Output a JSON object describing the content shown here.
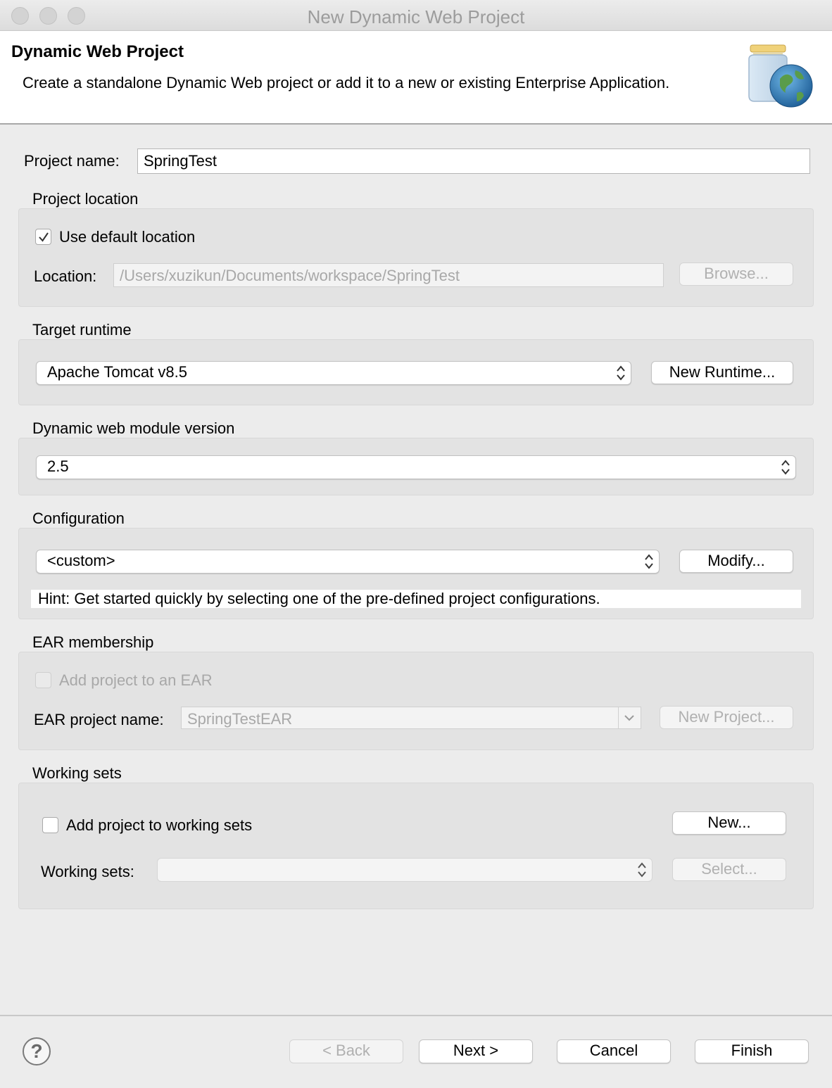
{
  "window": {
    "title": "New Dynamic Web Project"
  },
  "banner": {
    "title": "Dynamic Web Project",
    "description": "Create a standalone Dynamic Web project or add it to a new or existing Enterprise Application."
  },
  "project_name": {
    "label": "Project name:",
    "value": "SpringTest"
  },
  "project_location": {
    "title": "Project location",
    "use_default_label": "Use default location",
    "use_default_checked": true,
    "location_label": "Location:",
    "location_value": "/Users/xuzikun/Documents/workspace/SpringTest",
    "browse_label": "Browse..."
  },
  "target_runtime": {
    "title": "Target runtime",
    "selected": "Apache Tomcat v8.5",
    "new_runtime_label": "New Runtime..."
  },
  "module_version": {
    "title": "Dynamic web module version",
    "selected": "2.5"
  },
  "configuration": {
    "title": "Configuration",
    "selected": "<custom>",
    "modify_label": "Modify...",
    "hint": "Hint: Get started quickly by selecting one of the pre-defined project configurations."
  },
  "ear": {
    "title": "EAR membership",
    "add_label": "Add project to an EAR",
    "add_checked": false,
    "name_label": "EAR project name:",
    "name_value": "SpringTestEAR",
    "new_project_label": "New Project..."
  },
  "working_sets": {
    "title": "Working sets",
    "add_label": "Add project to working sets",
    "add_checked": false,
    "new_label": "New...",
    "sets_label": "Working sets:",
    "sets_value": "",
    "select_label": "Select..."
  },
  "footer": {
    "help_glyph": "?",
    "back_label": "< Back",
    "next_label": "Next >",
    "cancel_label": "Cancel",
    "finish_label": "Finish"
  },
  "colors": {
    "panel_bg": "#ececec",
    "group_bg": "#e3e3e3",
    "disabled_text": "#a8a8a8"
  }
}
